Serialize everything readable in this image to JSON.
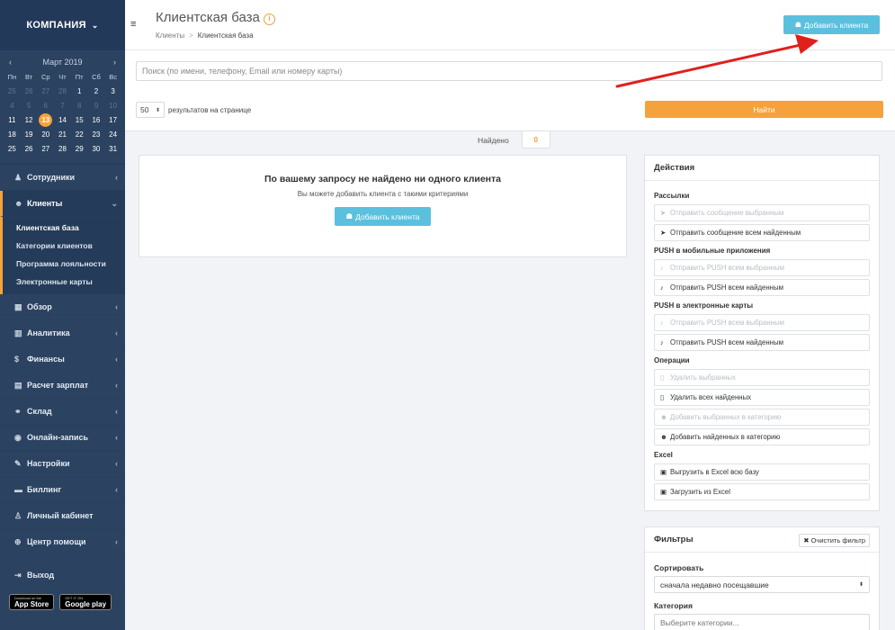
{
  "sidebar": {
    "company": "КОМПАНИЯ",
    "calendar": {
      "month": "Март 2019",
      "weekdays": [
        "Пн",
        "Вт",
        "Ср",
        "Чт",
        "Пт",
        "Сб",
        "Вс"
      ],
      "weeks": [
        [
          "25",
          "26",
          "27",
          "28",
          "1",
          "2",
          "3"
        ],
        [
          "4",
          "5",
          "6",
          "7",
          "8",
          "9",
          "10"
        ],
        [
          "11",
          "12",
          "13",
          "14",
          "15",
          "16",
          "17"
        ],
        [
          "18",
          "19",
          "20",
          "21",
          "22",
          "23",
          "24"
        ],
        [
          "25",
          "26",
          "27",
          "28",
          "29",
          "30",
          "31"
        ]
      ],
      "today": "13"
    },
    "items": [
      {
        "label": "Сотрудники",
        "icon": "user-icon"
      },
      {
        "label": "Клиенты",
        "icon": "users-icon"
      },
      {
        "label": "Обзор",
        "icon": "grid-icon"
      },
      {
        "label": "Аналитика",
        "icon": "chart-icon"
      },
      {
        "label": "Финансы",
        "icon": "dollar-icon"
      },
      {
        "label": "Расчет зарплат",
        "icon": "payroll-icon"
      },
      {
        "label": "Склад",
        "icon": "boxes-icon"
      },
      {
        "label": "Онлайн-запись",
        "icon": "globe-icon"
      },
      {
        "label": "Настройки",
        "icon": "wrench-icon"
      },
      {
        "label": "Биллинг",
        "icon": "card-icon"
      },
      {
        "label": "Личный кабинет",
        "icon": "person-icon"
      },
      {
        "label": "Центр помощи",
        "icon": "lifebuoy-icon"
      },
      {
        "label": "Выход",
        "icon": "logout-icon"
      }
    ],
    "submenu": [
      "Клиентская база",
      "Категории клиентов",
      "Программа лояльности",
      "Электронные карты"
    ],
    "stores": [
      {
        "small": "Download on the",
        "big": "App Store"
      },
      {
        "small": "GET IT ON",
        "big": "Google play"
      }
    ]
  },
  "header": {
    "title": "Клиентская база",
    "breadcrumb_root": "Клиенты",
    "breadcrumb_sep": ">",
    "breadcrumb_current": "Клиентская база",
    "add_client": "Добавить клиента"
  },
  "search": {
    "placeholder": "Поиск (по имени, телефону, Email или номеру карты)",
    "per_page_value": "50",
    "per_page_label": "результатов на странице",
    "find": "Найти"
  },
  "found": {
    "label": "Найдено",
    "count": "0"
  },
  "empty": {
    "title": "По вашему запросу не найдено ни одного клиента",
    "subtitle": "Вы можете добавить клиента с такими критериями",
    "button": "Добавить клиента"
  },
  "actions": {
    "title": "Действия",
    "groups": {
      "mail": "Рассылки",
      "push_apps": "PUSH в мобильные приложения",
      "push_cards": "PUSH в электронные карты",
      "ops": "Операции",
      "excel": "Excel"
    },
    "buttons": {
      "msg_selected": "Отправить сообщение выбранным",
      "msg_found": "Отправить сообщение всем найденным",
      "push_app_selected": "Отправить PUSH всем выбранным",
      "push_app_found": "Отправить PUSH всем найденным",
      "push_card_selected": "Отправить PUSH всем выбранным",
      "push_card_found": "Отправить PUSH всем найденным",
      "delete_selected": "Удалить выбранных",
      "delete_found": "Удалить всех найденных",
      "cat_selected": "Добавить выбранных в категорию",
      "cat_found": "Добавить найденных в категорию",
      "excel_export": "Выгрузить в Excel всю базу",
      "excel_import": "Загрузить из Excel"
    }
  },
  "filters": {
    "title": "Фильтры",
    "clear": "Очистить фильтр",
    "sort_label": "Сортировать",
    "sort_value": "сначала недавно посещавшие",
    "category_label": "Категория",
    "category_placeholder": "Выберите категории..."
  },
  "colors": {
    "sidebar": "#2b4361",
    "accent_orange": "#f6a23c",
    "info_blue": "#5bc0de",
    "annotation_red": "#e0201b"
  }
}
